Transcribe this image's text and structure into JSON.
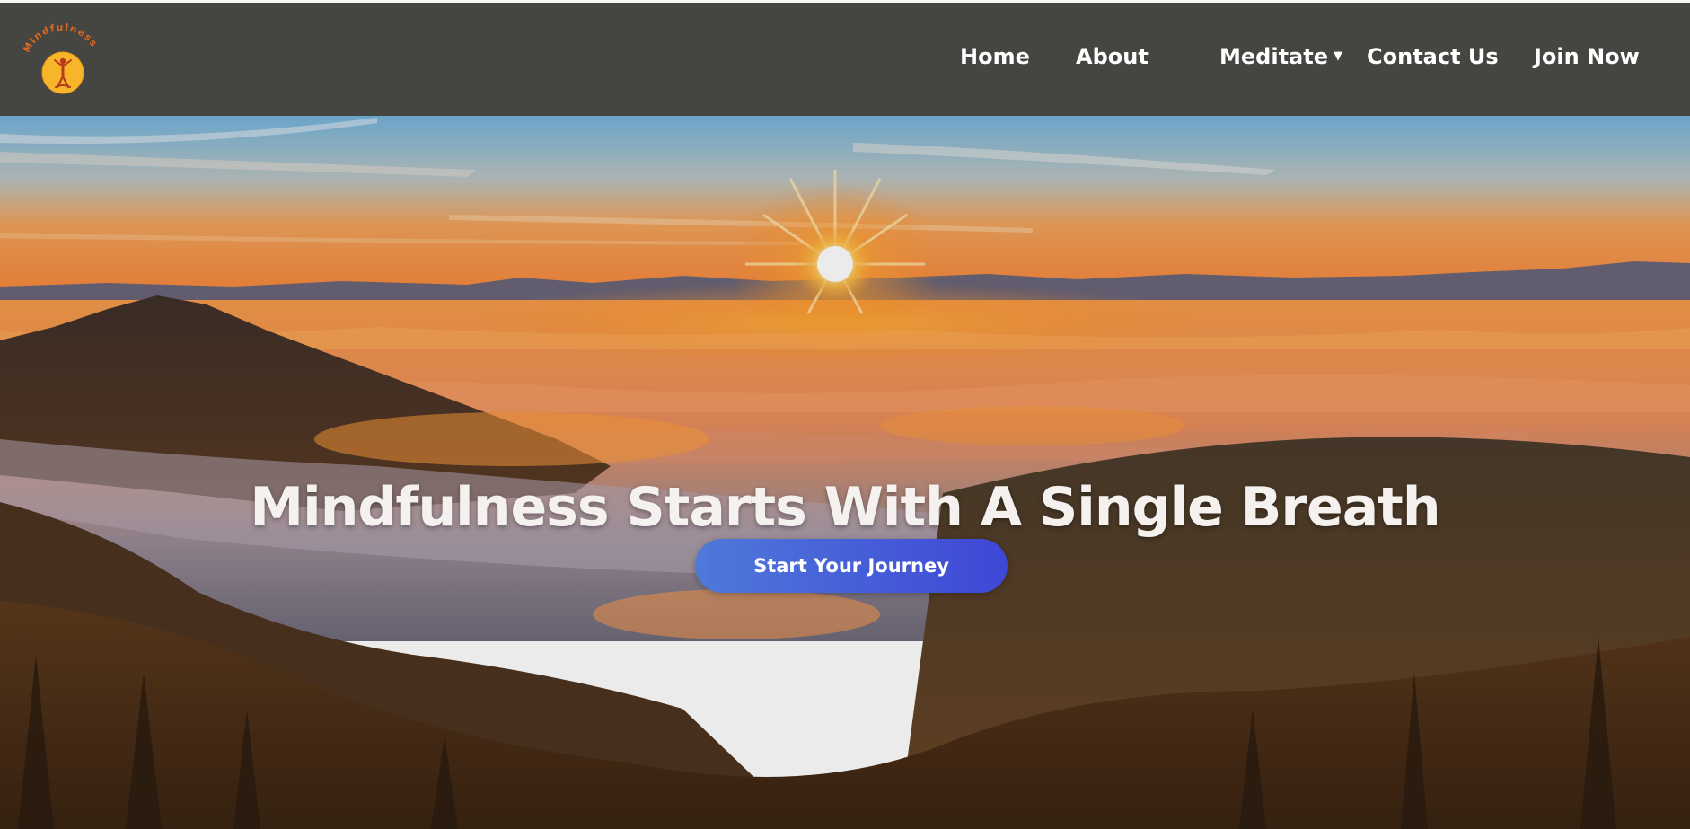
{
  "brand": {
    "logo_text": "Mindfulness",
    "logo_icon": "meditating-figure-sun-icon",
    "sun_color": "#f7b52a",
    "text_color": "#e0661f"
  },
  "nav": {
    "items": [
      {
        "label": "Home"
      },
      {
        "label": "About"
      },
      {
        "label": "Meditate",
        "dropdown_icon": "caret-down-icon",
        "dropdown_glyph": "▼"
      },
      {
        "label": "Contact Us"
      },
      {
        "label": "Join Now"
      }
    ],
    "background": "#454542",
    "text_color": "#ffffff"
  },
  "hero": {
    "title": "Mindfulness Starts With A Single Breath",
    "cta_label": "Start Your Journey",
    "cta_gradient": [
      "#4f79da",
      "#3e47d6"
    ],
    "background_image": "sunrise over sea of clouds and mountains"
  }
}
